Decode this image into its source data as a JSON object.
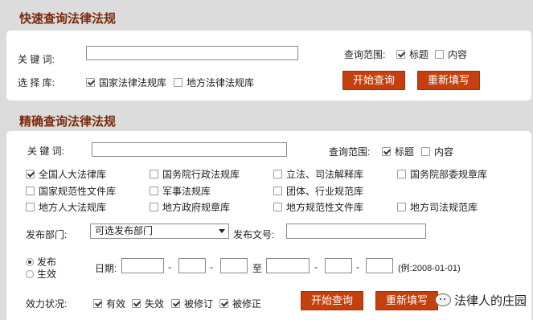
{
  "quick": {
    "title": "快速查询法律法规",
    "keyword_label": "关 键 词:",
    "keyword_value": "",
    "scope_label": "查询范围:",
    "scope_options": [
      {
        "label": "标题",
        "checked": true
      },
      {
        "label": "内容",
        "checked": false
      }
    ],
    "library_label": "选 择 库:",
    "library_options": [
      {
        "label": "国家法律法规库",
        "checked": true
      },
      {
        "label": "地方法律法规库",
        "checked": false
      }
    ],
    "search_button": "开始查询",
    "reset_button": "重新填写"
  },
  "precise": {
    "title": "精确查询法律法规",
    "keyword_label": "关 键 词:",
    "keyword_value": "",
    "scope_label": "查询范围:",
    "scope_options": [
      {
        "label": "标题",
        "checked": true
      },
      {
        "label": "内容",
        "checked": false
      }
    ],
    "libraries": [
      {
        "label": "全国人大法律库",
        "checked": true
      },
      {
        "label": "国务院行政法规库",
        "checked": false
      },
      {
        "label": "立法、司法解释库",
        "checked": false
      },
      {
        "label": "国务院部委规章库",
        "checked": false
      },
      {
        "label": "国家规范性文件库",
        "checked": false
      },
      {
        "label": "军事法规库",
        "checked": false
      },
      {
        "label": "团体、行业规范库",
        "checked": false
      },
      {
        "label": "地方人大法规库",
        "checked": false
      },
      {
        "label": "地方政府规章库",
        "checked": false
      },
      {
        "label": "地方规范性文件库",
        "checked": false
      },
      {
        "label": "地方司法规范库",
        "checked": false
      }
    ],
    "department_label": "发布部门:",
    "department_selected": "可选发布部门",
    "doc_number_label": "发布文号:",
    "doc_number_value": "",
    "date_type_options": [
      {
        "label": "发布",
        "selected": true
      },
      {
        "label": "生效",
        "selected": false
      }
    ],
    "date_label": "日期:",
    "date_to": "至",
    "date_sep": "-",
    "date_example": "(例:2008-01-01)",
    "status_label": "效力状况:",
    "status_options": [
      {
        "label": "有效",
        "checked": true
      },
      {
        "label": "失效",
        "checked": true
      },
      {
        "label": "被修订",
        "checked": true
      },
      {
        "label": "被修正",
        "checked": true
      }
    ],
    "search_button": "开始查询",
    "reset_button": "重新填写"
  },
  "watermark": {
    "text": "法律人的庄园",
    "icon": "wechat-icon"
  }
}
